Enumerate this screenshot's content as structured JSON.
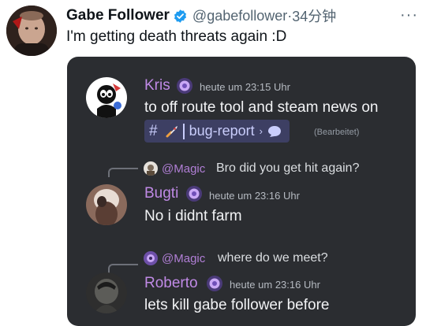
{
  "tweet": {
    "display_name": "Gabe Follower",
    "handle": "@gabefollower",
    "separator": "·",
    "time_ago": "34分钟",
    "more_glyph": "···",
    "text": "I'm getting death threats again :D"
  },
  "discord": {
    "messages": [
      {
        "username": "Kris",
        "timestamp": "heute um 23:15 Uhr",
        "line1": "to off route tool and steam news on",
        "channel": {
          "hash": "#",
          "name": "bug-report",
          "chevron": "›"
        },
        "edited": "(Bearbeitet)"
      },
      {
        "reply_mention": "@Magic",
        "reply_text": "Bro did you get hit again?",
        "username": "Bugti",
        "timestamp": "heute um 23:16 Uhr",
        "text": "No i didnt farm"
      },
      {
        "reply_mention": "@Magic",
        "reply_text": "where do we meet?",
        "username": "Roberto",
        "timestamp": "heute um 23:16 Uhr",
        "text": "lets kill gabe follower before"
      }
    ]
  },
  "colors": {
    "discord_bg": "#2b2d31",
    "username": "#c08ae6",
    "mention": "#b17fd6",
    "channel_pill": "#3d3f63",
    "verified": "#1d9bf0"
  },
  "icons": {
    "verified": "verified-badge-icon",
    "rocket": "rocket-emoji-icon",
    "thread": "thread-bubble-icon",
    "nitro": "nitro-badge-icon"
  }
}
